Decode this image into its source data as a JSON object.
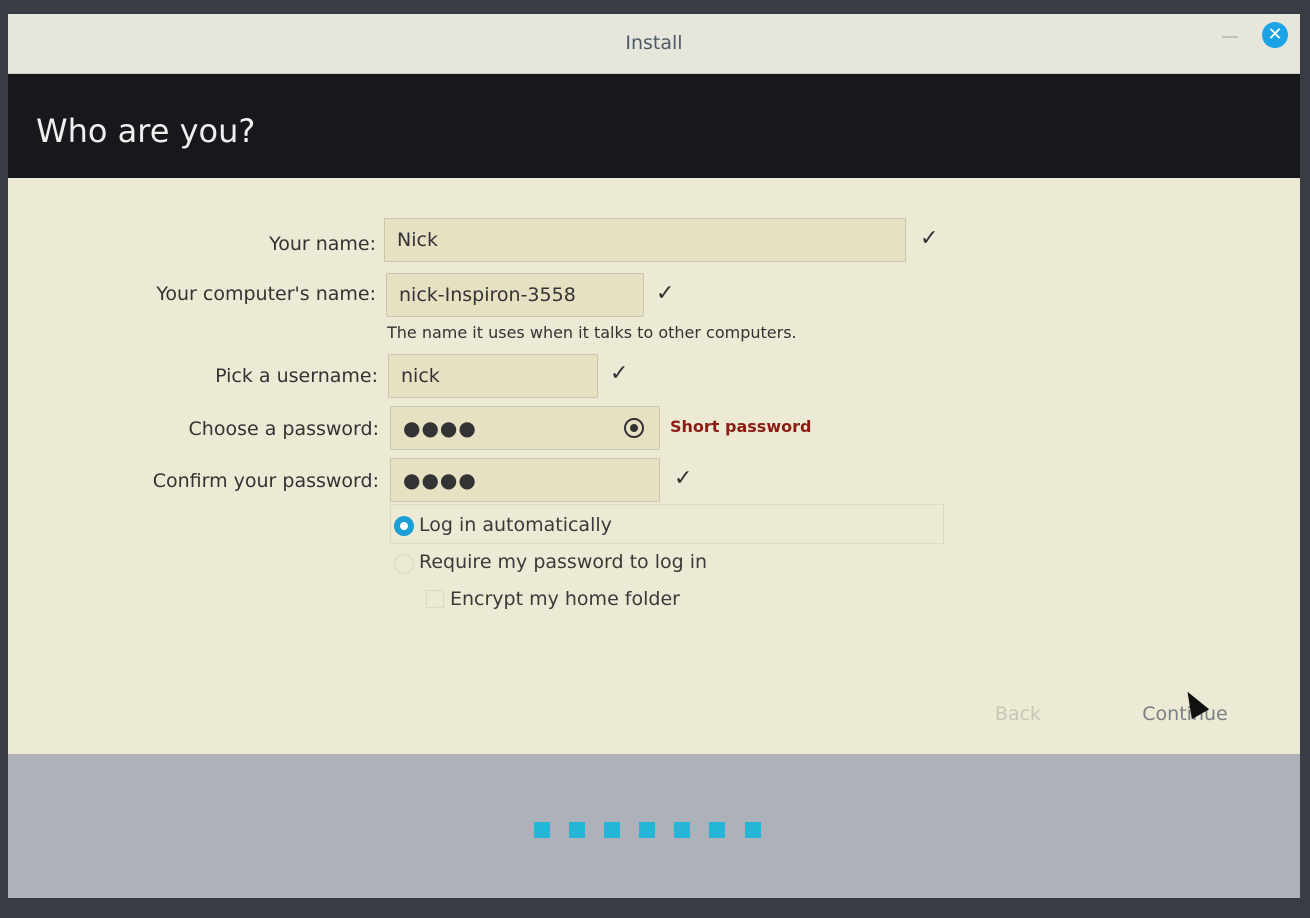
{
  "window": {
    "title": "Install",
    "close_icon": "✕"
  },
  "header": {
    "title": "Who are you?"
  },
  "form": {
    "name_label": "Your name:",
    "name_value": "Nick",
    "computer_label": "Your computer's name:",
    "computer_value": "nick-Inspiron-3558",
    "computer_hint": "The name it uses when it talks to other computers.",
    "username_label": "Pick a username:",
    "username_value": "nick",
    "password_label": "Choose a password:",
    "password_value": "●●●●",
    "password_warning": "Short password",
    "confirm_label": "Confirm your password:",
    "confirm_value": "●●●●",
    "check_mark": "✓"
  },
  "options": {
    "login_auto": "Log in automatically",
    "login_require": "Require my password to log in",
    "encrypt_home": "Encrypt my home folder"
  },
  "buttons": {
    "back": "Back",
    "continue": "Continue"
  },
  "progress": {
    "dots": 7
  },
  "colors": {
    "accent": "#23b6d6",
    "warning": "#8b1d12"
  }
}
